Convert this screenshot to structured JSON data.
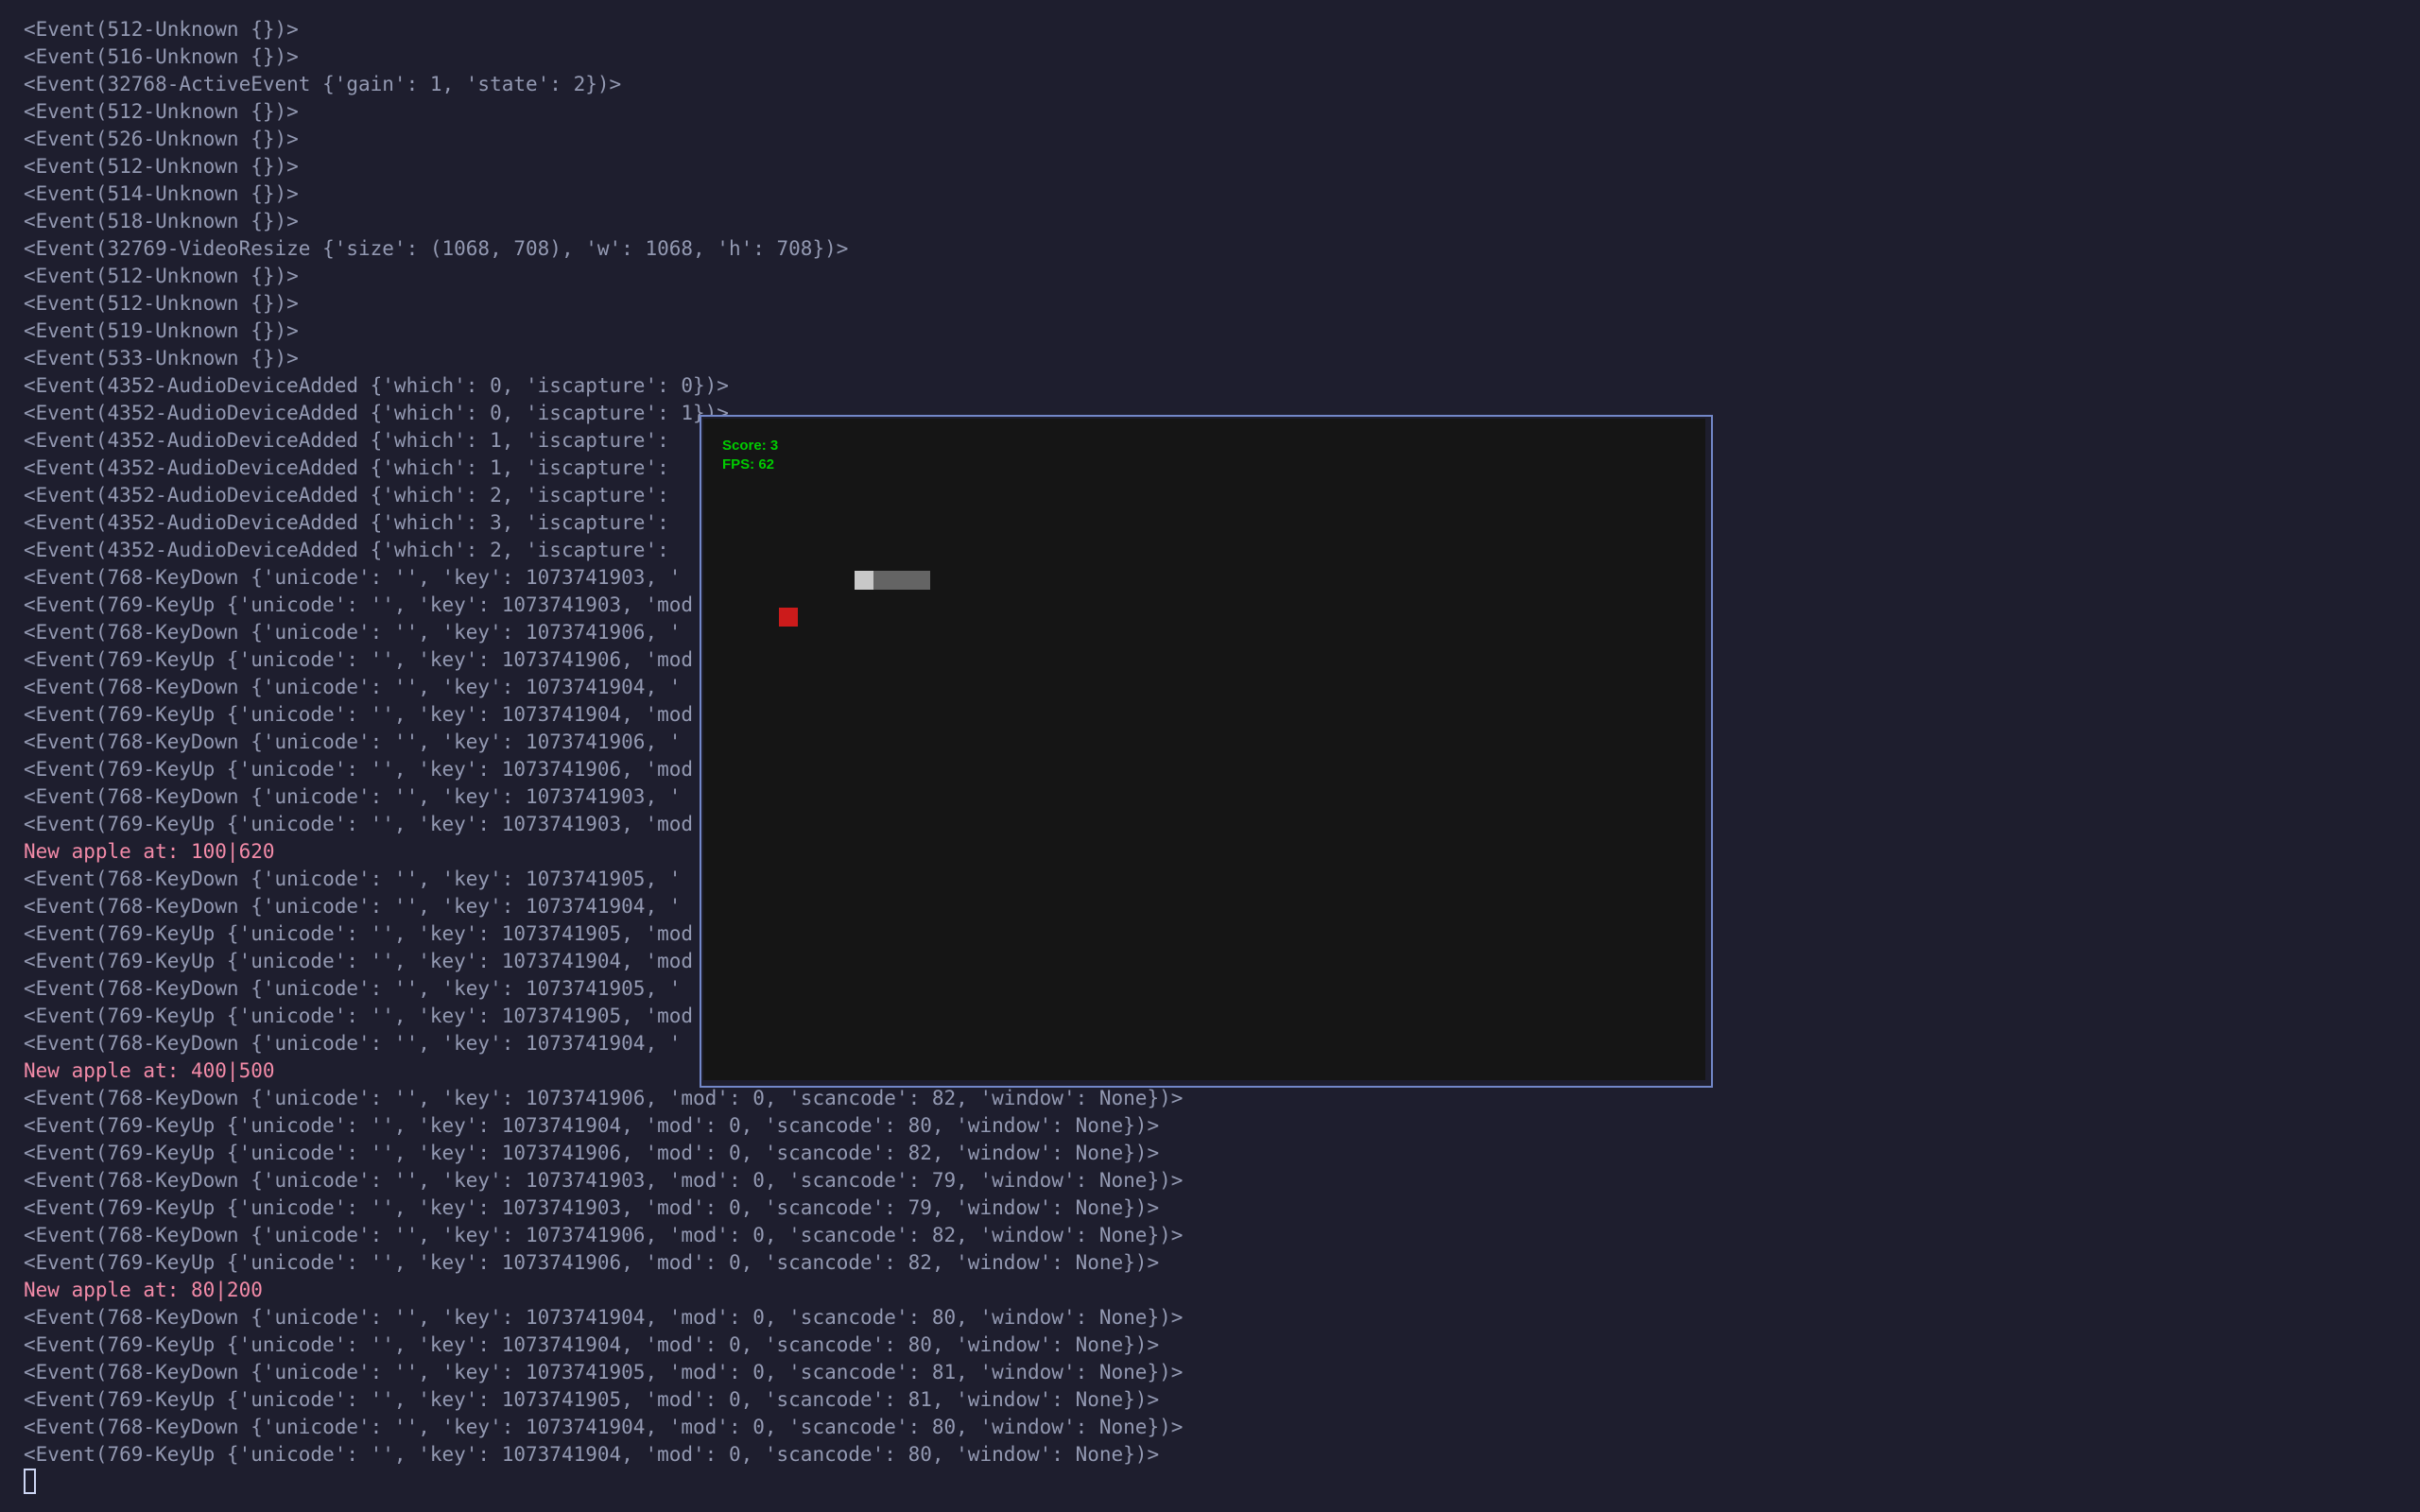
{
  "terminal": {
    "log_lines": [
      {
        "text": "<Event(512-Unknown {})>",
        "type": "event"
      },
      {
        "text": "<Event(516-Unknown {})>",
        "type": "event"
      },
      {
        "text": "<Event(32768-ActiveEvent {'gain': 1, 'state': 2})>",
        "type": "event"
      },
      {
        "text": "<Event(512-Unknown {})>",
        "type": "event"
      },
      {
        "text": "<Event(526-Unknown {})>",
        "type": "event"
      },
      {
        "text": "<Event(512-Unknown {})>",
        "type": "event"
      },
      {
        "text": "<Event(514-Unknown {})>",
        "type": "event"
      },
      {
        "text": "<Event(518-Unknown {})>",
        "type": "event"
      },
      {
        "text": "<Event(32769-VideoResize {'size': (1068, 708), 'w': 1068, 'h': 708})>",
        "type": "event"
      },
      {
        "text": "<Event(512-Unknown {})>",
        "type": "event"
      },
      {
        "text": "<Event(512-Unknown {})>",
        "type": "event"
      },
      {
        "text": "<Event(519-Unknown {})>",
        "type": "event"
      },
      {
        "text": "<Event(533-Unknown {})>",
        "type": "event"
      },
      {
        "text": "<Event(4352-AudioDeviceAdded {'which': 0, 'iscapture': 0})>",
        "type": "event"
      },
      {
        "text": "<Event(4352-AudioDeviceAdded {'which': 0, 'iscapture': 1})>",
        "type": "event"
      },
      {
        "text": "<Event(4352-AudioDeviceAdded {'which': 1, 'iscapture': ",
        "type": "event"
      },
      {
        "text": "<Event(4352-AudioDeviceAdded {'which': 1, 'iscapture': ",
        "type": "event"
      },
      {
        "text": "<Event(4352-AudioDeviceAdded {'which': 2, 'iscapture': ",
        "type": "event"
      },
      {
        "text": "<Event(4352-AudioDeviceAdded {'which': 3, 'iscapture': ",
        "type": "event"
      },
      {
        "text": "<Event(4352-AudioDeviceAdded {'which': 2, 'iscapture': ",
        "type": "event"
      },
      {
        "text": "<Event(768-KeyDown {'unicode': '', 'key': 1073741903, '",
        "type": "event"
      },
      {
        "text": "<Event(769-KeyUp {'unicode': '', 'key': 1073741903, 'mod",
        "type": "event"
      },
      {
        "text": "<Event(768-KeyDown {'unicode': '', 'key': 1073741906, '",
        "type": "event"
      },
      {
        "text": "<Event(769-KeyUp {'unicode': '', 'key': 1073741906, 'mod",
        "type": "event"
      },
      {
        "text": "<Event(768-KeyDown {'unicode': '', 'key': 1073741904, '",
        "type": "event"
      },
      {
        "text": "<Event(769-KeyUp {'unicode': '', 'key': 1073741904, 'mod",
        "type": "event"
      },
      {
        "text": "<Event(768-KeyDown {'unicode': '', 'key': 1073741906, '",
        "type": "event"
      },
      {
        "text": "<Event(769-KeyUp {'unicode': '', 'key': 1073741906, 'mod",
        "type": "event"
      },
      {
        "text": "<Event(768-KeyDown {'unicode': '', 'key': 1073741903, '",
        "type": "event"
      },
      {
        "text": "<Event(769-KeyUp {'unicode': '', 'key': 1073741903, 'mod",
        "type": "event"
      },
      {
        "text": "New apple at: 100|620",
        "type": "apple"
      },
      {
        "text": "<Event(768-KeyDown {'unicode': '', 'key': 1073741905, '",
        "type": "event"
      },
      {
        "text": "<Event(768-KeyDown {'unicode': '', 'key': 1073741904, '",
        "type": "event"
      },
      {
        "text": "<Event(769-KeyUp {'unicode': '', 'key': 1073741905, 'mod",
        "type": "event"
      },
      {
        "text": "<Event(769-KeyUp {'unicode': '', 'key': 1073741904, 'mod",
        "type": "event"
      },
      {
        "text": "<Event(768-KeyDown {'unicode': '', 'key': 1073741905, '",
        "type": "event"
      },
      {
        "text": "<Event(769-KeyUp {'unicode': '', 'key': 1073741905, 'mod",
        "type": "event"
      },
      {
        "text": "<Event(768-KeyDown {'unicode': '', 'key': 1073741904, '",
        "type": "event"
      },
      {
        "text": "New apple at: 400|500",
        "type": "apple"
      },
      {
        "text": "<Event(768-KeyDown {'unicode': '', 'key': 1073741906, 'mod': 0, 'scancode': 82, 'window': None})>",
        "type": "event"
      },
      {
        "text": "<Event(769-KeyUp {'unicode': '', 'key': 1073741904, 'mod': 0, 'scancode': 80, 'window': None})>",
        "type": "event"
      },
      {
        "text": "<Event(769-KeyUp {'unicode': '', 'key': 1073741906, 'mod': 0, 'scancode': 82, 'window': None})>",
        "type": "event"
      },
      {
        "text": "<Event(768-KeyDown {'unicode': '', 'key': 1073741903, 'mod': 0, 'scancode': 79, 'window': None})>",
        "type": "event"
      },
      {
        "text": "<Event(769-KeyUp {'unicode': '', 'key': 1073741903, 'mod': 0, 'scancode': 79, 'window': None})>",
        "type": "event"
      },
      {
        "text": "<Event(768-KeyDown {'unicode': '', 'key': 1073741906, 'mod': 0, 'scancode': 82, 'window': None})>",
        "type": "event"
      },
      {
        "text": "<Event(769-KeyUp {'unicode': '', 'key': 1073741906, 'mod': 0, 'scancode': 82, 'window': None})>",
        "type": "event"
      },
      {
        "text": "New apple at: 80|200",
        "type": "apple"
      },
      {
        "text": "<Event(768-KeyDown {'unicode': '', 'key': 1073741904, 'mod': 0, 'scancode': 80, 'window': None})>",
        "type": "event"
      },
      {
        "text": "<Event(769-KeyUp {'unicode': '', 'key': 1073741904, 'mod': 0, 'scancode': 80, 'window': None})>",
        "type": "event"
      },
      {
        "text": "<Event(768-KeyDown {'unicode': '', 'key': 1073741905, 'mod': 0, 'scancode': 81, 'window': None})>",
        "type": "event"
      },
      {
        "text": "<Event(769-KeyUp {'unicode': '', 'key': 1073741905, 'mod': 0, 'scancode': 81, 'window': None})>",
        "type": "event"
      },
      {
        "text": "<Event(768-KeyDown {'unicode': '', 'key': 1073741904, 'mod': 0, 'scancode': 80, 'window': None})>",
        "type": "event"
      },
      {
        "text": "<Event(769-KeyUp {'unicode': '', 'key': 1073741904, 'mod': 0, 'scancode': 80, 'window': None})>",
        "type": "event"
      }
    ]
  },
  "game": {
    "score_text": "Score: 3",
    "fps_text": "FPS: 62",
    "apple_color": "#cc1b1b",
    "snake_head_color": "#c8c8c8",
    "snake_body_color": "#646464",
    "hud_color": "#00cc00"
  }
}
